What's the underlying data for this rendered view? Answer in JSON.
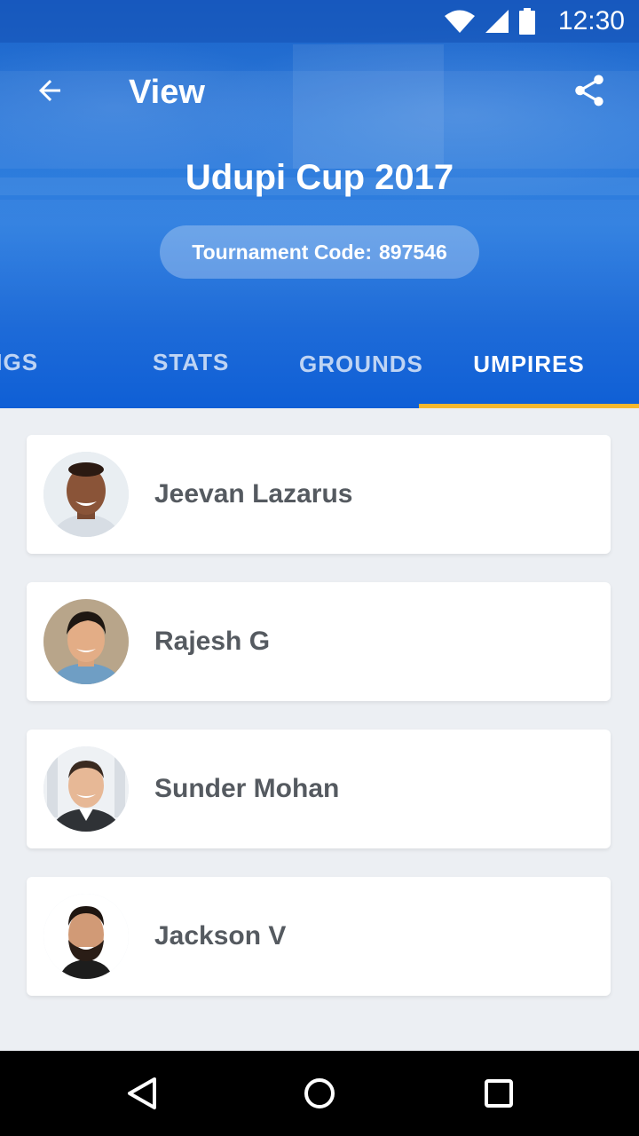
{
  "status_bar": {
    "time": "12:30"
  },
  "app_bar": {
    "title": "View"
  },
  "tournament": {
    "name": "Udupi Cup 2017",
    "code_label": "Tournament Code:",
    "code_value": "897546"
  },
  "tabs": [
    {
      "label": "NDINGS"
    },
    {
      "label": "STATS"
    },
    {
      "label": "GROUNDS"
    },
    {
      "label": "UMPIRES"
    }
  ],
  "colors": {
    "primary": "#1f6cd8",
    "tab_indicator": "#f5b82e",
    "list_background": "#eceff3"
  },
  "umpires": [
    {
      "name": "Jeevan Lazarus",
      "avatar_icon": "avatar-photo"
    },
    {
      "name": "Rajesh G",
      "avatar_icon": "avatar-photo"
    },
    {
      "name": "Sunder Mohan",
      "avatar_icon": "avatar-photo"
    },
    {
      "name": "Jackson V",
      "avatar_icon": "avatar-photo"
    }
  ]
}
